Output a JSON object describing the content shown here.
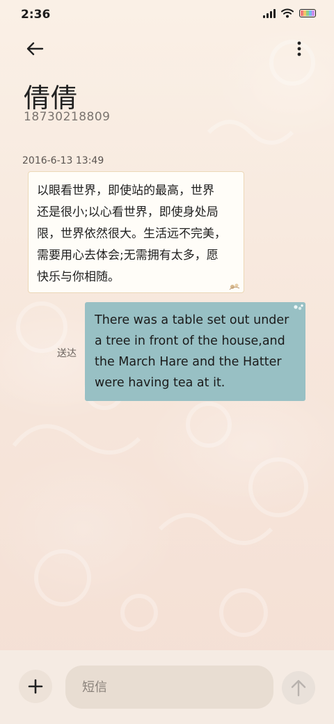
{
  "status_bar": {
    "time": "2:36",
    "icons": [
      "signal-icon",
      "wifi-icon",
      "battery-icon"
    ]
  },
  "header": {
    "back_icon": "arrow-left-icon",
    "more_icon": "more-vertical-icon"
  },
  "contact": {
    "name": "倩倩",
    "number": "18730218809"
  },
  "conversation": {
    "timestamp": "2016-6-13 13:49",
    "incoming_message": "以眼看世界，即使站的最高，世界\n还是很小;以心看世界，即使身处局\n限，世界依然很大。生活远不完美，\n需要用心去体会;无需拥有太多，愿\n快乐与你相随。",
    "outgoing_message": "There was a table set out under a tree in front of the house,and the March Hare and the Hatter were having tea at it.",
    "outgoing_status": "送达"
  },
  "composer": {
    "add_icon": "plus-icon",
    "input_placeholder": "短信",
    "input_value": "",
    "send_icon": "arrow-up-icon"
  },
  "colors": {
    "background": "#f7e9df",
    "incoming_bubble": "#fffdf8",
    "outgoing_bubble": "#98c0c4",
    "composer_bar": "#f5ebe3",
    "input_field": "#e8ddd2"
  }
}
